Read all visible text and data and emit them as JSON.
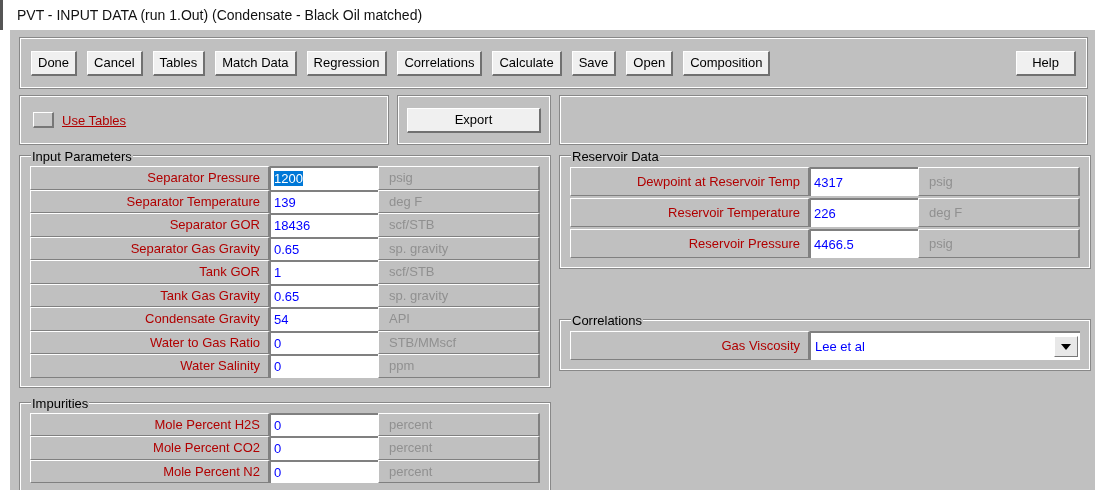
{
  "window": {
    "title": "PVT - INPUT DATA (run 1.Out)  (Condensate - Black Oil matched)"
  },
  "toolbar": {
    "buttons": [
      "Done",
      "Cancel",
      "Tables",
      "Match Data",
      "Regression",
      "Correlations",
      "Calculate",
      "Save",
      "Open",
      "Composition"
    ],
    "help": "Help"
  },
  "use_tables": {
    "label": "Use Tables",
    "checked": false
  },
  "export_button": "Export",
  "input_parameters": {
    "title": "Input Parameters",
    "rows": [
      {
        "label": "Separator Pressure",
        "value": "1200",
        "unit": "psig",
        "highlighted": true
      },
      {
        "label": "Separator Temperature",
        "value": "139",
        "unit": "deg F",
        "highlighted": false
      },
      {
        "label": "Separator GOR",
        "value": "18436",
        "unit": "scf/STB",
        "highlighted": false
      },
      {
        "label": "Separator Gas Gravity",
        "value": "0.65",
        "unit": "sp. gravity",
        "highlighted": false
      },
      {
        "label": "Tank GOR",
        "value": "1",
        "unit": "scf/STB",
        "highlighted": false
      },
      {
        "label": "Tank Gas Gravity",
        "value": "0.65",
        "unit": "sp. gravity",
        "highlighted": false
      },
      {
        "label": "Condensate Gravity",
        "value": "54",
        "unit": "API",
        "highlighted": false
      },
      {
        "label": "Water to Gas Ratio",
        "value": "0",
        "unit": "STB/MMscf",
        "highlighted": false
      },
      {
        "label": "Water Salinity",
        "value": "0",
        "unit": "ppm",
        "highlighted": false
      }
    ]
  },
  "impurities": {
    "title": "Impurities",
    "rows": [
      {
        "label": "Mole Percent H2S",
        "value": "0",
        "unit": "percent",
        "highlighted": false
      },
      {
        "label": "Mole Percent CO2",
        "value": "0",
        "unit": "percent",
        "highlighted": false
      },
      {
        "label": "Mole Percent N2",
        "value": "0",
        "unit": "percent",
        "highlighted": false
      }
    ]
  },
  "reservoir_data": {
    "title": "Reservoir Data",
    "rows": [
      {
        "label": "Dewpoint at Reservoir Temp",
        "value": "4317",
        "unit": "psig",
        "highlighted": false
      },
      {
        "label": "Reservoir Temperature",
        "value": "226",
        "unit": "deg F",
        "highlighted": false
      },
      {
        "label": "Reservoir Pressure",
        "value": "4466.5",
        "unit": "psig",
        "highlighted": false
      }
    ]
  },
  "correlations": {
    "title": "Correlations",
    "rows": [
      {
        "label": "Gas Viscosity",
        "value": "Lee et al"
      }
    ]
  }
}
